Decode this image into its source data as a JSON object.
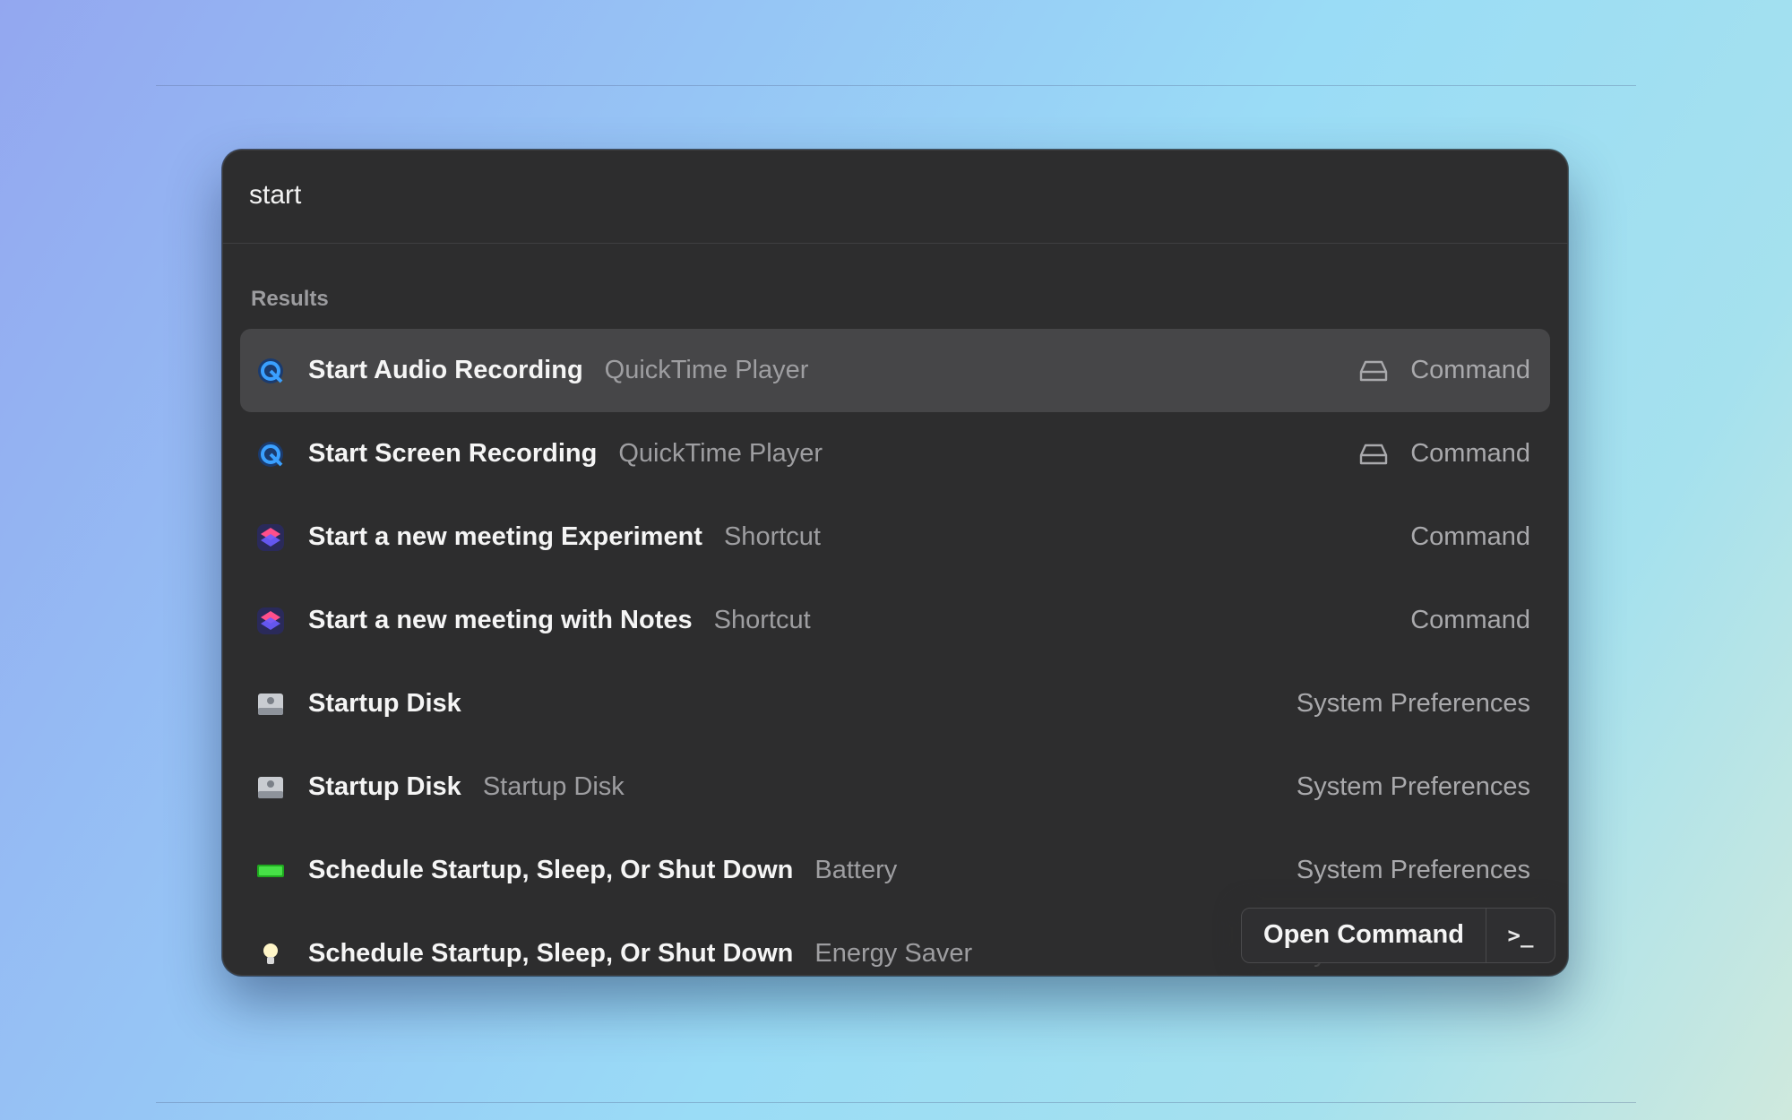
{
  "search": {
    "value": "start"
  },
  "section_title": "Results",
  "results": [
    {
      "title": "Start Audio Recording",
      "subtitle": "QuickTime Player",
      "accessory": "Command",
      "icon": "quicktime-icon",
      "accessory_icon": "drive-icon",
      "selected": true
    },
    {
      "title": "Start Screen Recording",
      "subtitle": "QuickTime Player",
      "accessory": "Command",
      "icon": "quicktime-icon",
      "accessory_icon": "drive-icon"
    },
    {
      "title": "Start a new meeting Experiment",
      "subtitle": "Shortcut",
      "accessory": "Command",
      "icon": "shortcuts-icon"
    },
    {
      "title": "Start a new meeting with Notes",
      "subtitle": "Shortcut",
      "accessory": "Command",
      "icon": "shortcuts-icon"
    },
    {
      "title": "Startup Disk",
      "subtitle": "",
      "accessory": "System Preferences",
      "icon": "startup-disk-icon"
    },
    {
      "title": "Startup Disk",
      "subtitle": "Startup Disk",
      "accessory": "System Preferences",
      "icon": "startup-disk-icon"
    },
    {
      "title": "Schedule Startup, Sleep, Or Shut Down",
      "subtitle": "Battery",
      "accessory": "System Preferences",
      "icon": "battery-icon"
    },
    {
      "title": "Schedule Startup, Sleep, Or Shut Down",
      "subtitle": "Energy Saver",
      "accessory": "System Preferences",
      "icon": "lightbulb-icon"
    }
  ],
  "action_bar": {
    "primary_label": "Open Command",
    "shortcut_symbol": ">_"
  },
  "colors": {
    "selected_row": "#464648",
    "window_bg": "#2d2d2e",
    "text_primary": "#f5f5f5",
    "text_secondary": "#9e9ea1"
  }
}
